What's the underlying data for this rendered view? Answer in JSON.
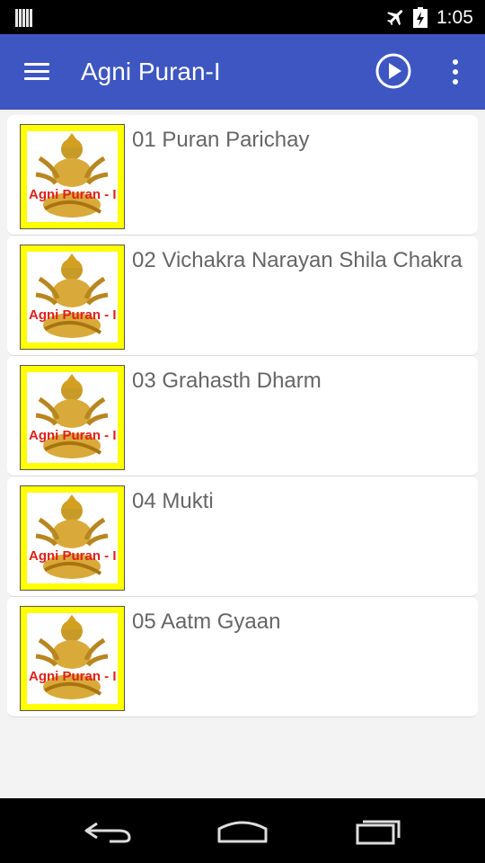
{
  "status_bar": {
    "time": "1:05",
    "icons": [
      "notification-icon",
      "airplane-mode-icon",
      "battery-charging-icon"
    ]
  },
  "app_bar": {
    "title": "Agni Puran-I",
    "menu_icon": "hamburger-menu-icon",
    "play_icon": "play-circle-icon",
    "more_icon": "more-vert-icon",
    "color": "#3d56c1"
  },
  "list": {
    "thumbnail_caption": "Agni Puran - I",
    "items": [
      {
        "label": "01 Puran Parichay"
      },
      {
        "label": "02 Vichakra Narayan Shila Chakra"
      },
      {
        "label": "03 Grahasth Dharm"
      },
      {
        "label": "04 Mukti"
      },
      {
        "label": "05 Aatm Gyaan"
      }
    ]
  },
  "nav_bar": {
    "icons": [
      "back-icon",
      "home-icon",
      "recents-icon"
    ]
  }
}
